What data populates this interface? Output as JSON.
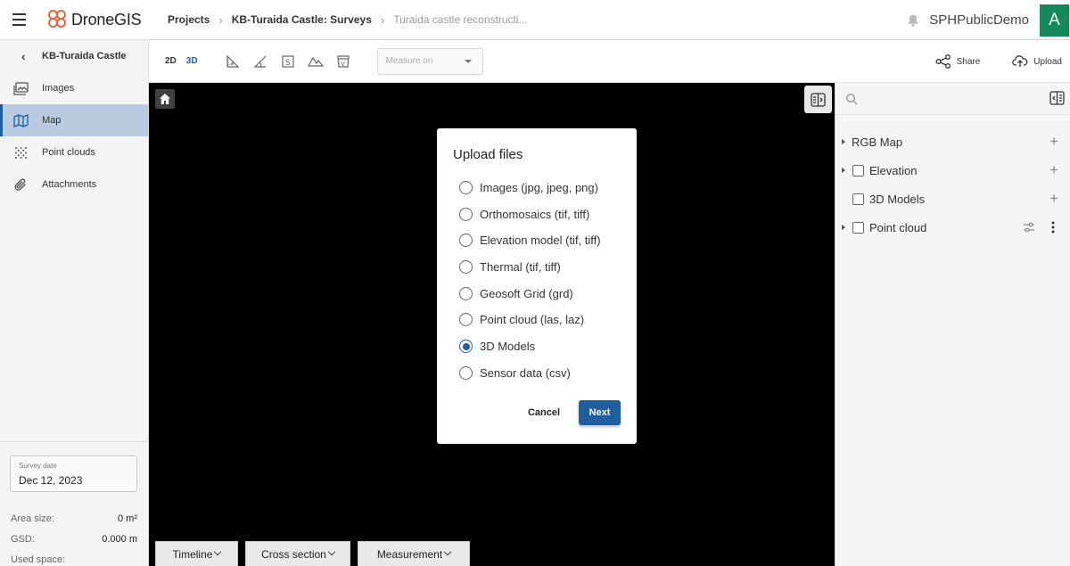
{
  "app": {
    "name": "DroneGIS",
    "brand_color": "#e8643a",
    "accent": "#1f5fa0"
  },
  "breadcrumb": {
    "items": [
      "Projects",
      "KB-Turaida Castle: Surveys",
      "Turaida castle reconstructi..."
    ]
  },
  "user": {
    "name": "SPHPublicDemo",
    "avatar_letter": "A",
    "avatar_color": "#168a5d"
  },
  "sidebar": {
    "back_label": "KB-Turaida Castle",
    "items": [
      {
        "label": "Images",
        "icon": "images-icon",
        "active": false
      },
      {
        "label": "Map",
        "icon": "map-icon",
        "active": true
      },
      {
        "label": "Point clouds",
        "icon": "point-cloud-icon",
        "active": false
      },
      {
        "label": "Attachments",
        "icon": "paperclip-icon",
        "active": false
      }
    ],
    "survey_date_label": "Survey date",
    "survey_date_value": "Dec 12, 2023",
    "stats": [
      {
        "label": "Area size:",
        "value": "0 m²"
      },
      {
        "label": "GSD:",
        "value": "0.000 m"
      },
      {
        "label": "Used space:",
        "value": ""
      }
    ]
  },
  "toolbar": {
    "view_2d": "2D",
    "view_3d": "3D",
    "measure_placeholder": "Measure on",
    "share_label": "Share",
    "upload_label": "Upload"
  },
  "bottom_tabs": [
    "Timeline",
    "Cross section",
    "Measurement"
  ],
  "layers": [
    {
      "label": "RGB Map"
    },
    {
      "label": "Elevation"
    },
    {
      "label": "3D Models"
    },
    {
      "label": "Point cloud"
    }
  ],
  "modal": {
    "title": "Upload files",
    "options": [
      "Images (jpg, jpeg, png)",
      "Orthomosaics (tif, tiff)",
      "Elevation model (tif, tiff)",
      "Thermal (tif, tiff)",
      "Geosoft Grid (grd)",
      "Point cloud (las, laz)",
      "3D Models",
      "Sensor data (csv)"
    ],
    "selected": "3D Models",
    "cancel_label": "Cancel",
    "next_label": "Next"
  }
}
